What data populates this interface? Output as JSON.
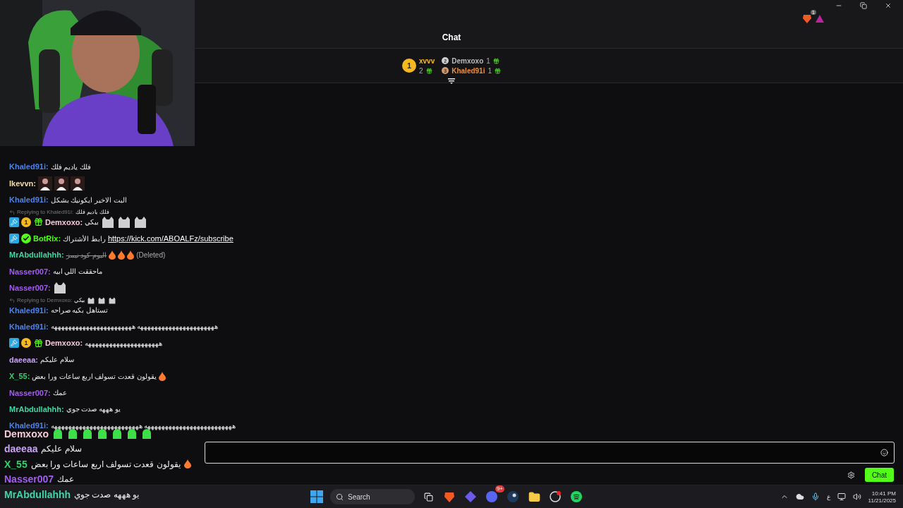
{
  "window": {
    "extension_badge": "1"
  },
  "chat": {
    "title": "Chat",
    "leaderboard": {
      "first": {
        "rank": "1",
        "user": "xvvv",
        "count": "2"
      },
      "runners_up": [
        {
          "rank": "2",
          "user": "Demxoxo",
          "count": "1"
        },
        {
          "rank": "3",
          "user": "Khaled91i",
          "count": "1"
        }
      ]
    },
    "messages": [
      {
        "user": "Khaled91i:",
        "color": "#4d83e6",
        "text": "فلك ياديم فلك"
      },
      {
        "user": "Ikevvn:",
        "color": "#f2dba8",
        "emotes": [
          {
            "kind": "person"
          },
          {
            "kind": "person"
          },
          {
            "kind": "person"
          }
        ]
      },
      {
        "user": "Khaled91i:",
        "color": "#4d83e6",
        "text": "البت الاخير ايكونيك بشكل"
      },
      {
        "reply": {
          "label": "Replying to Khaled91i:",
          "text": "فلك ياديم فلك"
        }
      },
      {
        "user": "Demxoxo:",
        "color": "#f6c9d6",
        "badges": [
          {
            "kind": "mod"
          },
          {
            "kind": "sub",
            "label": "1"
          },
          {
            "kind": "gift"
          }
        ],
        "text": "بيكي",
        "emotes": [
          {
            "kind": "cat"
          },
          {
            "kind": "cat"
          },
          {
            "kind": "cat"
          }
        ]
      },
      {
        "user": "BotRix:",
        "color": "#53fc18",
        "badges": [
          {
            "kind": "mod"
          },
          {
            "kind": "verified"
          }
        ],
        "text": "رابط الأشتراك",
        "link": "https://kick.com/ABOALFz/subscribe"
      },
      {
        "user": "MrAbdullahhh:",
        "color": "#3ed6a6",
        "text": "اليوم كود نيمز",
        "deleted": true,
        "deleted_label": "(Deleted)",
        "emotes": [
          {
            "kind": "fire"
          },
          {
            "kind": "fire"
          },
          {
            "kind": "fire"
          }
        ]
      },
      {
        "user": "Nasser007:",
        "color": "#a45cf2",
        "text": "ماحققت اللي ابيه"
      },
      {
        "user": "Nasser007:",
        "color": "#a45cf2",
        "emotes": [
          {
            "kind": "cat"
          }
        ]
      },
      {
        "reply": {
          "label": "Replying to Demxoxo:",
          "text": "بيكي",
          "emotes": [
            {
              "kind": "cat"
            },
            {
              "kind": "cat"
            },
            {
              "kind": "cat"
            }
          ]
        }
      },
      {
        "user": "Khaled91i:",
        "color": "#4d83e6",
        "text": "تستاهل بكيه صراحه"
      },
      {
        "user": "Khaled91i:",
        "color": "#4d83e6",
        "text": "ههههههههههههههههههههههه هههههههههههههههههههههههه"
      },
      {
        "user": "Demxoxo:",
        "color": "#f6c9d6",
        "badges": [
          {
            "kind": "mod"
          },
          {
            "kind": "sub",
            "label": "1"
          },
          {
            "kind": "gift"
          }
        ],
        "text": "هههههههههههههههههههههه"
      },
      {
        "user": "daeeaa:",
        "color": "#c8a2f2",
        "text": "سلام عليكم"
      },
      {
        "user": "X_55:",
        "color": "#2ed36b",
        "text": "يقولون قعدت تسولف اربع ساعات ورا بعض",
        "emotes": [
          {
            "kind": "fire"
          }
        ]
      },
      {
        "user": "Nasser007:",
        "color": "#a45cf2",
        "text": "عمك"
      },
      {
        "user": "MrAbdullahhh:",
        "color": "#3ed6a6",
        "text": "يو هههه صدت جوي"
      },
      {
        "user": "Khaled91i:",
        "color": "#4d83e6",
        "text": "هههههههههههههههههههههههههه هههههههههههههههههههههههههه"
      }
    ],
    "send_button": "Chat"
  },
  "stream_overlay_chat": [
    {
      "user": "Demxoxo",
      "color": "#f6c9d6",
      "emotes": [
        {
          "kind": "green"
        },
        {
          "kind": "green"
        },
        {
          "kind": "green"
        },
        {
          "kind": "green"
        },
        {
          "kind": "green"
        },
        {
          "kind": "green"
        },
        {
          "kind": "green"
        }
      ]
    },
    {
      "user": "daeeaa",
      "color": "#c8a2f2",
      "text": "سلام عليكم"
    },
    {
      "user": "X_55",
      "color": "#2ed36b",
      "text": "يقولون قعدت تسولف اربع ساعات ورا بعض",
      "emotes": [
        {
          "kind": "fire"
        }
      ]
    },
    {
      "user": "Nasser007",
      "color": "#a45cf2",
      "text": "عمك"
    },
    {
      "user": "MrAbdullahhh",
      "color": "#3ed6a6",
      "text": "يو هههه صدت جوي"
    }
  ],
  "taskbar": {
    "search_placeholder": "Search",
    "discord_badge": "9+",
    "keyboard_language": "ع",
    "time": "10:41 PM",
    "date": "11/21/2025"
  }
}
